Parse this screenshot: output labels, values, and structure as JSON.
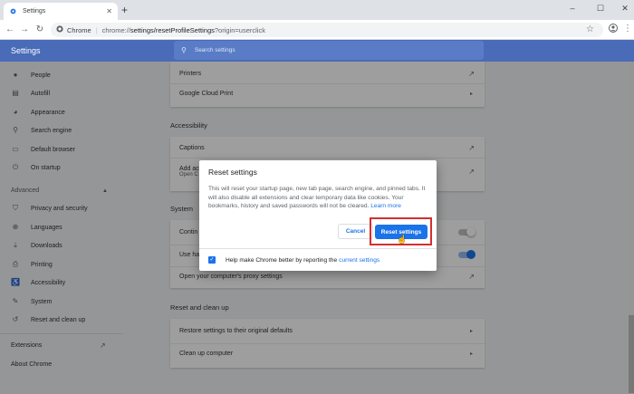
{
  "browser": {
    "tab_title": "Settings",
    "tab_close": "✕",
    "new_tab": "+",
    "win_minimize": "–",
    "win_maximize": "☐",
    "win_close": "✕",
    "site_label": "Chrome",
    "url_scheme": "chrome://",
    "url_path": "settings/resetProfileSettings",
    "url_query": "?origin=userclick"
  },
  "header": {
    "title": "Settings",
    "search_placeholder": "Search settings"
  },
  "sidebar": {
    "items": [
      {
        "label": "People",
        "icon": "person-icon"
      },
      {
        "label": "Autofill",
        "icon": "clipboard-icon"
      },
      {
        "label": "Appearance",
        "icon": "palette-icon"
      },
      {
        "label": "Search engine",
        "icon": "search-icon"
      },
      {
        "label": "Default browser",
        "icon": "browser-icon"
      },
      {
        "label": "On startup",
        "icon": "power-icon"
      }
    ],
    "advanced_label": "Advanced",
    "advanced_items": [
      {
        "label": "Privacy and security",
        "icon": "shield-icon"
      },
      {
        "label": "Languages",
        "icon": "globe-icon"
      },
      {
        "label": "Downloads",
        "icon": "download-icon"
      },
      {
        "label": "Printing",
        "icon": "printer-icon"
      },
      {
        "label": "Accessibility",
        "icon": "accessibility-icon"
      },
      {
        "label": "System",
        "icon": "wrench-icon"
      },
      {
        "label": "Reset and clean up",
        "icon": "history-icon"
      }
    ],
    "extensions_label": "Extensions",
    "about_label": "About Chrome"
  },
  "main": {
    "printing_rows": [
      "Printers",
      "Google Cloud Print"
    ],
    "accessibility_title": "Accessibility",
    "accessibility_rows": [
      "Captions",
      "Add ac",
      "Open C"
    ],
    "system_title": "System",
    "system_rows": [
      "Contin",
      "Use ha",
      "Open your computer's proxy settings"
    ],
    "reset_title": "Reset and clean up",
    "reset_rows": [
      "Restore settings to their original defaults",
      "Clean up computer"
    ]
  },
  "dialog": {
    "title": "Reset settings",
    "body": "This will reset your startup page, new tab page, search engine, and pinned tabs. It will also disable all extensions and clear temporary data like cookies. Your bookmarks, history and saved passwords will not be cleared.",
    "learn_more": "Learn more",
    "cancel_label": "Cancel",
    "reset_label": "Reset settings",
    "footer_text": "Help make Chrome better by reporting the",
    "footer_link": "current settings",
    "checkbox_checked": true
  },
  "colors": {
    "header": "#4a6bb8",
    "accent": "#1a73e8",
    "highlight": "#d32f2f"
  }
}
